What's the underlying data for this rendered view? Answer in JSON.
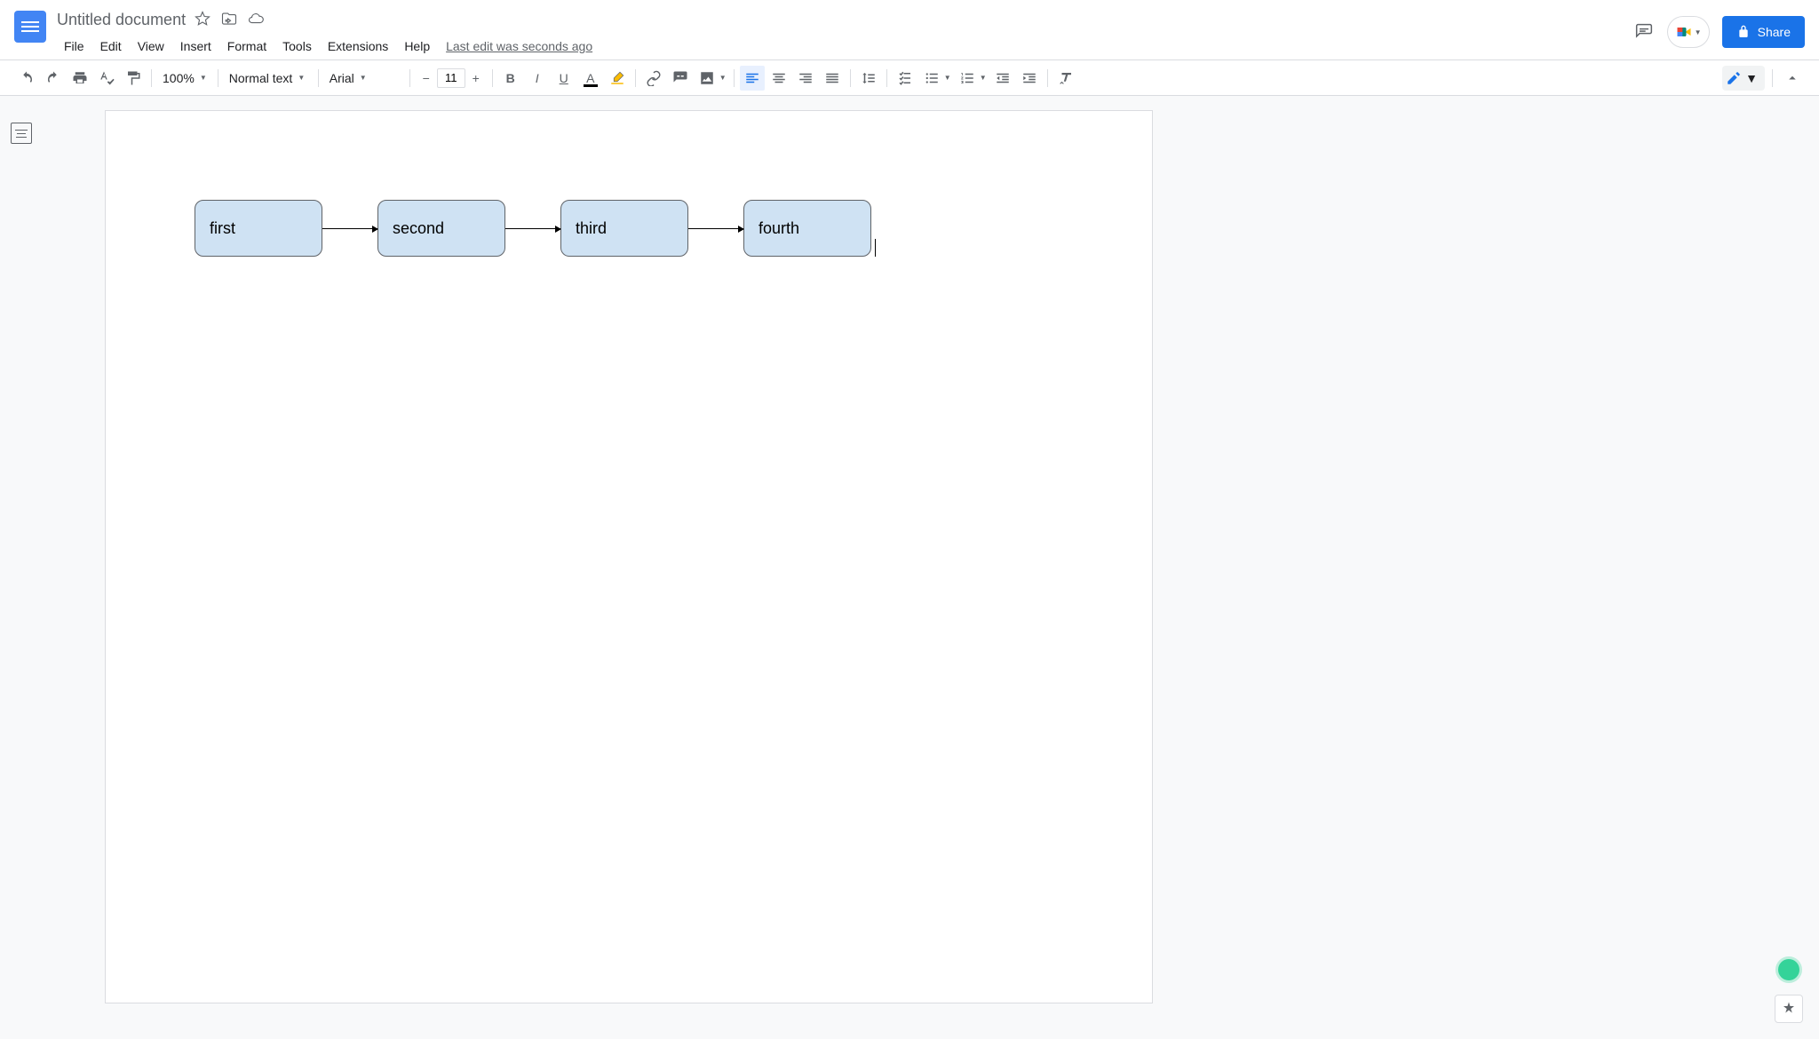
{
  "header": {
    "title": "Untitled document",
    "menus": [
      "File",
      "Edit",
      "View",
      "Insert",
      "Format",
      "Tools",
      "Extensions",
      "Help"
    ],
    "last_edit": "Last edit was seconds ago",
    "share_label": "Share"
  },
  "toolbar": {
    "zoom": "100%",
    "style": "Normal text",
    "font": "Arial",
    "font_size": "11"
  },
  "diagram": {
    "nodes": [
      "first",
      "second",
      "third",
      "fourth"
    ]
  }
}
